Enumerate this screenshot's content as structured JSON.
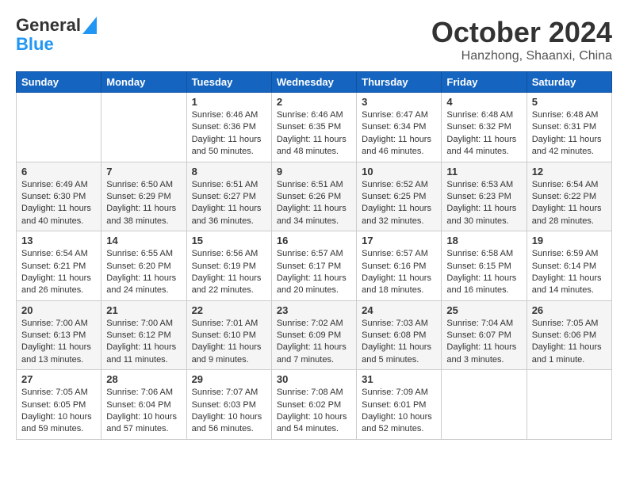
{
  "header": {
    "logo_line1": "General",
    "logo_line2": "Blue",
    "month": "October 2024",
    "location": "Hanzhong, Shaanxi, China"
  },
  "weekdays": [
    "Sunday",
    "Monday",
    "Tuesday",
    "Wednesday",
    "Thursday",
    "Friday",
    "Saturday"
  ],
  "weeks": [
    [
      {
        "day": "",
        "info": ""
      },
      {
        "day": "",
        "info": ""
      },
      {
        "day": "1",
        "info": "Sunrise: 6:46 AM\nSunset: 6:36 PM\nDaylight: 11 hours and 50 minutes."
      },
      {
        "day": "2",
        "info": "Sunrise: 6:46 AM\nSunset: 6:35 PM\nDaylight: 11 hours and 48 minutes."
      },
      {
        "day": "3",
        "info": "Sunrise: 6:47 AM\nSunset: 6:34 PM\nDaylight: 11 hours and 46 minutes."
      },
      {
        "day": "4",
        "info": "Sunrise: 6:48 AM\nSunset: 6:32 PM\nDaylight: 11 hours and 44 minutes."
      },
      {
        "day": "5",
        "info": "Sunrise: 6:48 AM\nSunset: 6:31 PM\nDaylight: 11 hours and 42 minutes."
      }
    ],
    [
      {
        "day": "6",
        "info": "Sunrise: 6:49 AM\nSunset: 6:30 PM\nDaylight: 11 hours and 40 minutes."
      },
      {
        "day": "7",
        "info": "Sunrise: 6:50 AM\nSunset: 6:29 PM\nDaylight: 11 hours and 38 minutes."
      },
      {
        "day": "8",
        "info": "Sunrise: 6:51 AM\nSunset: 6:27 PM\nDaylight: 11 hours and 36 minutes."
      },
      {
        "day": "9",
        "info": "Sunrise: 6:51 AM\nSunset: 6:26 PM\nDaylight: 11 hours and 34 minutes."
      },
      {
        "day": "10",
        "info": "Sunrise: 6:52 AM\nSunset: 6:25 PM\nDaylight: 11 hours and 32 minutes."
      },
      {
        "day": "11",
        "info": "Sunrise: 6:53 AM\nSunset: 6:23 PM\nDaylight: 11 hours and 30 minutes."
      },
      {
        "day": "12",
        "info": "Sunrise: 6:54 AM\nSunset: 6:22 PM\nDaylight: 11 hours and 28 minutes."
      }
    ],
    [
      {
        "day": "13",
        "info": "Sunrise: 6:54 AM\nSunset: 6:21 PM\nDaylight: 11 hours and 26 minutes."
      },
      {
        "day": "14",
        "info": "Sunrise: 6:55 AM\nSunset: 6:20 PM\nDaylight: 11 hours and 24 minutes."
      },
      {
        "day": "15",
        "info": "Sunrise: 6:56 AM\nSunset: 6:19 PM\nDaylight: 11 hours and 22 minutes."
      },
      {
        "day": "16",
        "info": "Sunrise: 6:57 AM\nSunset: 6:17 PM\nDaylight: 11 hours and 20 minutes."
      },
      {
        "day": "17",
        "info": "Sunrise: 6:57 AM\nSunset: 6:16 PM\nDaylight: 11 hours and 18 minutes."
      },
      {
        "day": "18",
        "info": "Sunrise: 6:58 AM\nSunset: 6:15 PM\nDaylight: 11 hours and 16 minutes."
      },
      {
        "day": "19",
        "info": "Sunrise: 6:59 AM\nSunset: 6:14 PM\nDaylight: 11 hours and 14 minutes."
      }
    ],
    [
      {
        "day": "20",
        "info": "Sunrise: 7:00 AM\nSunset: 6:13 PM\nDaylight: 11 hours and 13 minutes."
      },
      {
        "day": "21",
        "info": "Sunrise: 7:00 AM\nSunset: 6:12 PM\nDaylight: 11 hours and 11 minutes."
      },
      {
        "day": "22",
        "info": "Sunrise: 7:01 AM\nSunset: 6:10 PM\nDaylight: 11 hours and 9 minutes."
      },
      {
        "day": "23",
        "info": "Sunrise: 7:02 AM\nSunset: 6:09 PM\nDaylight: 11 hours and 7 minutes."
      },
      {
        "day": "24",
        "info": "Sunrise: 7:03 AM\nSunset: 6:08 PM\nDaylight: 11 hours and 5 minutes."
      },
      {
        "day": "25",
        "info": "Sunrise: 7:04 AM\nSunset: 6:07 PM\nDaylight: 11 hours and 3 minutes."
      },
      {
        "day": "26",
        "info": "Sunrise: 7:05 AM\nSunset: 6:06 PM\nDaylight: 11 hours and 1 minute."
      }
    ],
    [
      {
        "day": "27",
        "info": "Sunrise: 7:05 AM\nSunset: 6:05 PM\nDaylight: 10 hours and 59 minutes."
      },
      {
        "day": "28",
        "info": "Sunrise: 7:06 AM\nSunset: 6:04 PM\nDaylight: 10 hours and 57 minutes."
      },
      {
        "day": "29",
        "info": "Sunrise: 7:07 AM\nSunset: 6:03 PM\nDaylight: 10 hours and 56 minutes."
      },
      {
        "day": "30",
        "info": "Sunrise: 7:08 AM\nSunset: 6:02 PM\nDaylight: 10 hours and 54 minutes."
      },
      {
        "day": "31",
        "info": "Sunrise: 7:09 AM\nSunset: 6:01 PM\nDaylight: 10 hours and 52 minutes."
      },
      {
        "day": "",
        "info": ""
      },
      {
        "day": "",
        "info": ""
      }
    ]
  ]
}
